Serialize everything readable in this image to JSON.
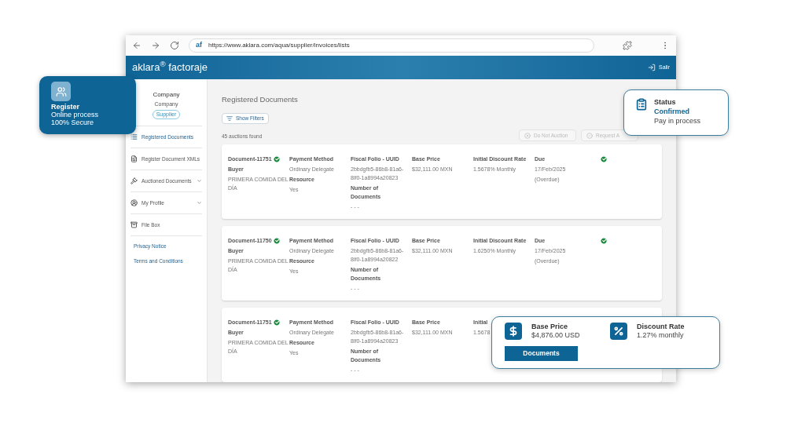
{
  "browser": {
    "site_icon": "af",
    "url": "https://www.aklara.com/aqua/supplier/invoices/lists"
  },
  "header": {
    "brand": "aklara$^{®}$ factoraje",
    "logout": "Salir"
  },
  "sidebar": {
    "company": "Company",
    "subtitle": "Company",
    "role": "Supplier",
    "items": [
      {
        "label": "Registered Documents",
        "kind": "list",
        "selected": true,
        "expandable": false
      },
      {
        "label": "Register Document XMLs",
        "kind": "file",
        "selected": false,
        "expandable": false
      },
      {
        "label": "Auctioned Documents",
        "kind": "gavel",
        "selected": false,
        "expandable": true
      },
      {
        "label": "My Profile",
        "kind": "profile",
        "selected": false,
        "expandable": true
      },
      {
        "label": "File Box",
        "kind": "box",
        "selected": false,
        "expandable": false
      }
    ],
    "links": [
      "Privacy Notice",
      "Terms and Conditions"
    ]
  },
  "main": {
    "title": "Registered Documents",
    "filter_button": "Show Filters",
    "count": "45 auctions found",
    "actions": [
      {
        "label": "Do Not Auction",
        "kind": "cancel"
      },
      {
        "label": "Request A",
        "kind": "confirm"
      }
    ]
  },
  "documents": [
    {
      "title": "Document-11751",
      "verified": true,
      "status_check": true,
      "buyer_label": "Buyer",
      "buyer": "PRIMERA COMIDA DEL DÍA",
      "payment_label": "Payment Method",
      "payment": "Ordinary Delegate",
      "resource_label": "Resource",
      "resource": "Yes",
      "folio_label": "Fiscal Folio - UUID",
      "folio": "2bbdgfb5-86b8-81a6-8lf0-1a8994a20823",
      "number_label": "Number of Documents",
      "number": "- - -",
      "price_label": "Base Price",
      "price": "$32,111.00 MXN",
      "rate_label": "Initial Discount Rate",
      "rate": "1.5678% Monthly",
      "due_label": "Due",
      "due": "17/Feb/2025",
      "due_note": "(Overdue)"
    },
    {
      "title": "Document-11750",
      "verified": true,
      "status_check": true,
      "buyer_label": "Buyer",
      "buyer": "PRIMERA COMIDA DEL DÍA",
      "payment_label": "Payment Method",
      "payment": "Ordinary Delegate",
      "resource_label": "Resource",
      "resource": "Yes",
      "folio_label": "Fiscal Folio - UUID",
      "folio": "2bbdgfb5-86b8-81a6-8lf0-1a8994a20822",
      "number_label": "Number of Documents",
      "number": "- - -",
      "price_label": "Base Price",
      "price": "$32,111.00 MXN",
      "rate_label": "Initial Discount Rate",
      "rate": "1.6250% Monthly",
      "due_label": "Due",
      "due": "17/Feb/2025",
      "due_note": "(Overdue)"
    },
    {
      "title": "Document-11751",
      "verified": true,
      "buyer_label": "Buyer",
      "buyer": "PRIMERA COMIDA DEL DÍA",
      "payment_label": "Payment Method",
      "payment": "Ordinary Delegate",
      "resource_label": "Resource",
      "resource": "Yes",
      "folio_label": "Fiscal Folio - UUID",
      "folio": "2bbdgfb5-86b8-81a6-8lf0-1a8994a20823",
      "number_label": "Number of Documents",
      "number": "- - -",
      "price_label": "Base Price",
      "price": "$32,111.00 MXN",
      "rate_label": "Initial",
      "rate": "1.5678"
    }
  ],
  "register_card": {
    "title": "Register",
    "lines": [
      "Online process",
      "100% Secure"
    ]
  },
  "status_card": {
    "title": "Status",
    "value": "Confirmed",
    "note": "Pay in process"
  },
  "summary_card": {
    "items": [
      {
        "label": "Base Price",
        "value": "$4,876.00 USD",
        "kind": "price"
      },
      {
        "label": "Discount Rate",
        "value": "1.27% monthly",
        "kind": "rate"
      }
    ],
    "button": "Documents"
  }
}
